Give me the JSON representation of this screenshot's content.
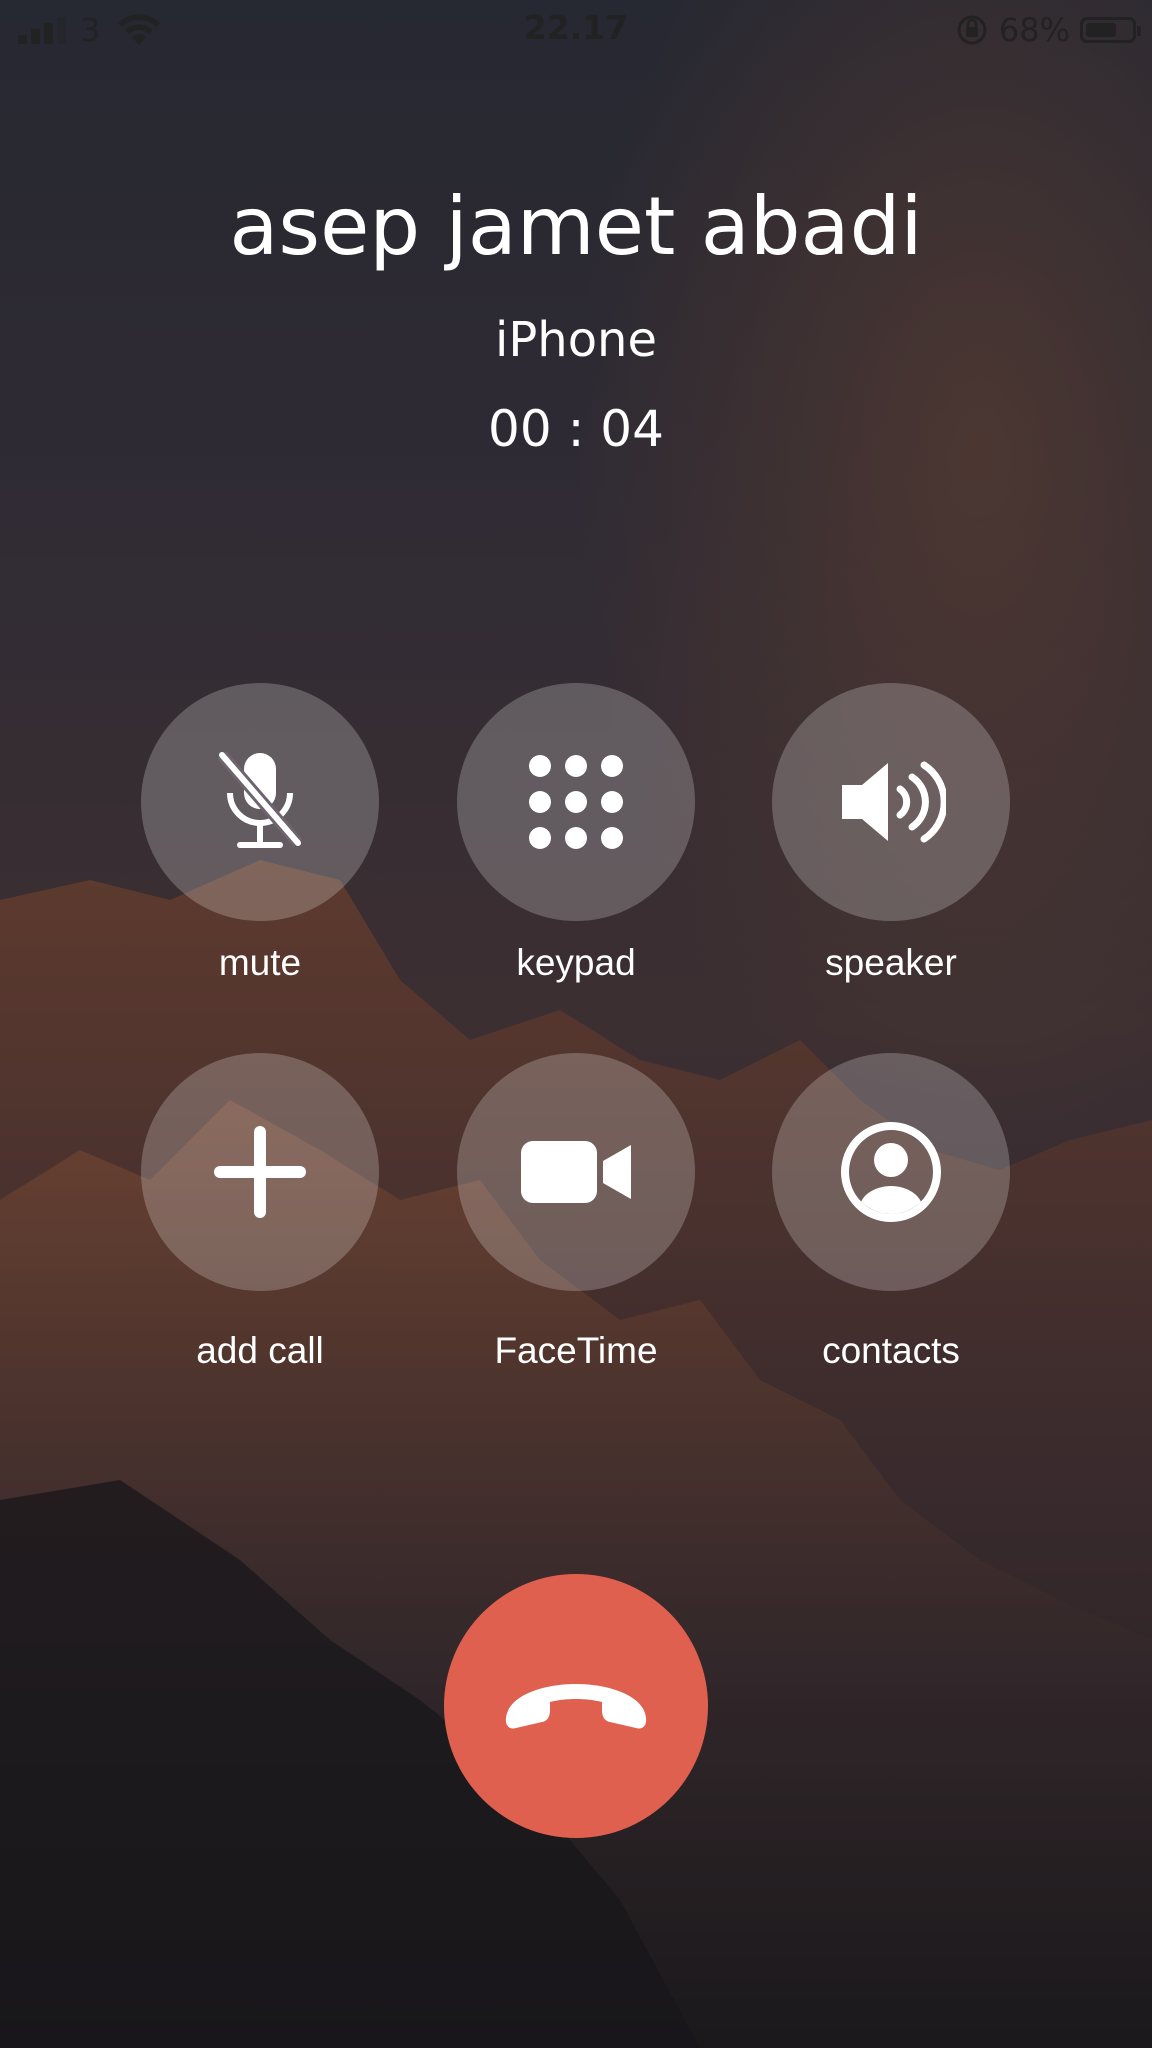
{
  "status_bar": {
    "carrier": "3",
    "time": "22.17",
    "battery_percent_text": "68%",
    "battery_level": 0.68,
    "icons": [
      "signal-icon",
      "wifi-icon",
      "orientation-lock-icon",
      "battery-icon"
    ]
  },
  "call": {
    "name": "asep jamet abadi",
    "source": "iPhone",
    "duration": "00 : 04"
  },
  "controls": {
    "mute": {
      "label": "mute",
      "icon": "mic-slash-icon"
    },
    "keypad": {
      "label": "keypad",
      "icon": "keypad-icon"
    },
    "speaker": {
      "label": "speaker",
      "icon": "speaker-icon"
    },
    "add_call": {
      "label": "add call",
      "icon": "plus-icon"
    },
    "facetime": {
      "label": "FaceTime",
      "icon": "video-camera-icon"
    },
    "contacts": {
      "label": "contacts",
      "icon": "person-circle-icon"
    }
  },
  "end_call": {
    "icon": "phone-hangup-icon",
    "color": "#df604f"
  },
  "colors": {
    "button_bg": "rgba(255,255,255,0.22)",
    "status_text": "#222222",
    "foreground": "#ffffff"
  }
}
